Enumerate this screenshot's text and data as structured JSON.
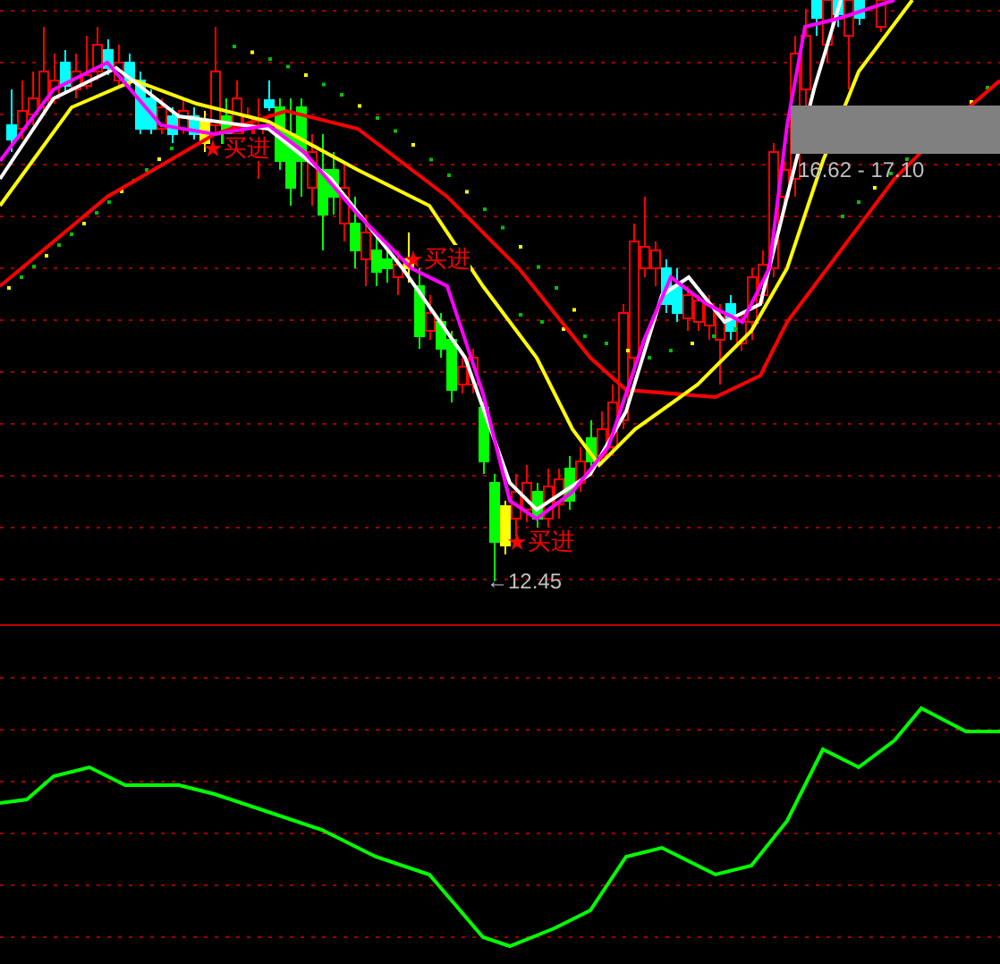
{
  "main_chart": {
    "buy_signals": [
      {
        "label": "买进"
      },
      {
        "label": "买进"
      },
      {
        "label": "买进"
      }
    ],
    "low_price_label": "←12.45",
    "price_range_label": "16.62 - 17.10"
  }
}
